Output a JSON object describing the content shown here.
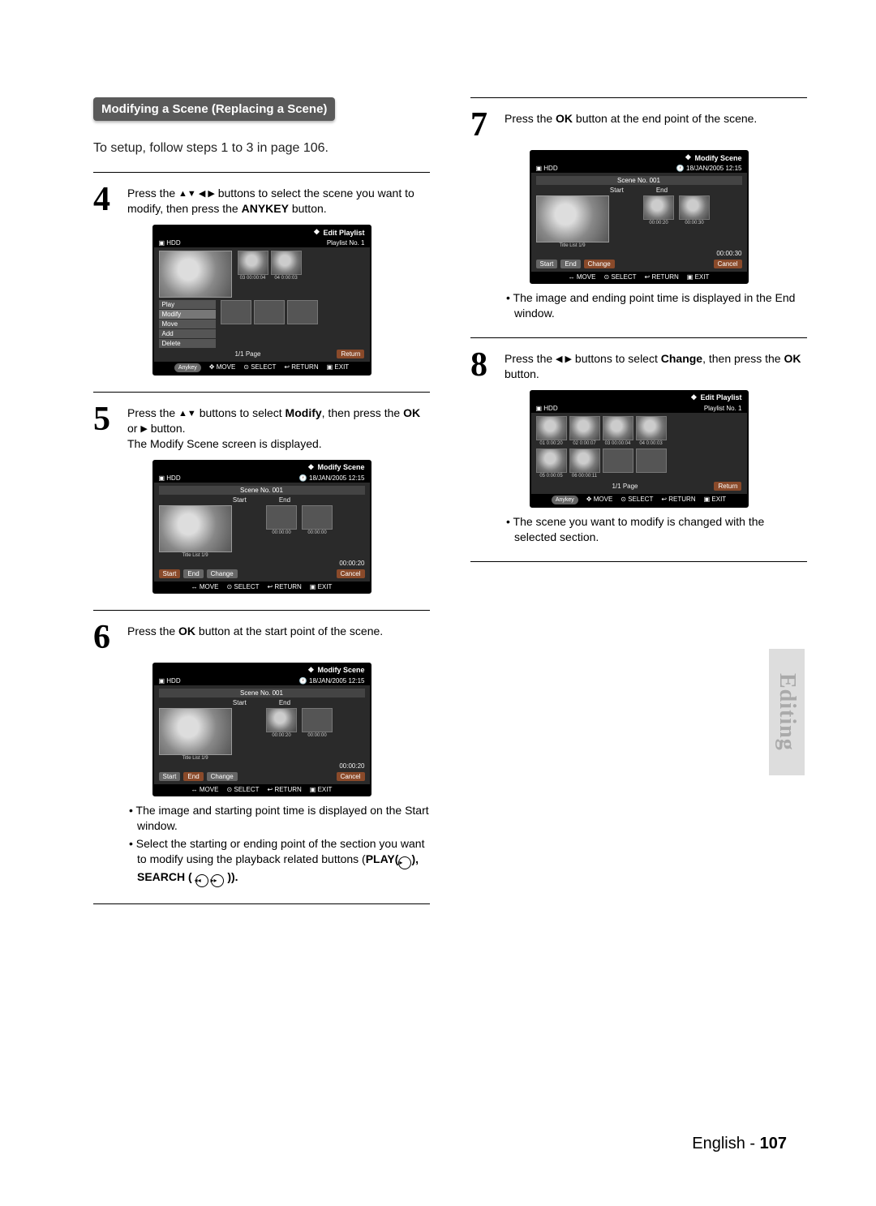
{
  "heading": "Modifying a Scene (Replacing a Scene)",
  "intro": "To setup, follow steps 1 to 3 in page 106.",
  "steps": {
    "s4": {
      "num": "4",
      "text_a": "Press the ",
      "text_b": " buttons to select the scene you want to modify, then press the ",
      "bold": "ANYKEY",
      "text_c": " button."
    },
    "s5": {
      "num": "5",
      "text_a": "Press the ",
      "text_b": " buttons to select ",
      "bold1": "Modify",
      "text_c": ", then press the ",
      "bold2": "OK",
      "text_d": " or ",
      "text_e": " button.",
      "line2": "The Modify Scene screen is displayed."
    },
    "s6": {
      "num": "6",
      "text_a": "Press the ",
      "bold": "OK",
      "text_b": " button at the start point of the scene."
    },
    "s6_bullets": {
      "b1": "The image and starting point time is displayed on the Start window.",
      "b2_a": "Select the starting or ending point of the section you want to modify using the playback related buttons (",
      "b2_play": "PLAY(",
      "b2_sep": "), ",
      "b2_search": "SEARCH (",
      "b2_end": " ))."
    },
    "s7": {
      "num": "7",
      "text_a": "Press the ",
      "bold": "OK",
      "text_b": " button at the end point of the scene."
    },
    "s7_bullet": "The image and ending point time is displayed in the End window.",
    "s8": {
      "num": "8",
      "text_a": "Press the ",
      "text_b": " buttons to select ",
      "bold1": "Change",
      "text_c": ", then press the ",
      "bold2": "OK",
      "text_d": " button."
    },
    "s8_bullet": "The scene you want to modify is changed with the selected section."
  },
  "arrows": {
    "udlr": "▲▼ ◀ ▶",
    "ud": "▲▼",
    "right": "▶",
    "lr": "◀ ▶"
  },
  "ss_common": {
    "hdd": "HDD",
    "date": "18/JAN/2005 12:15",
    "move": "MOVE",
    "select": "SELECT",
    "return": "RETURN",
    "exit": "EXIT",
    "playlist_no": "Playlist No. 1",
    "scene_no": "Scene No. 001",
    "start": "Start",
    "end": "End",
    "change": "Change",
    "cancel": "Cancel",
    "title_list": "Title List 1/9",
    "page": "1/1 Page",
    "return_btn": "Return",
    "anykey": "Anykey"
  },
  "ss4": {
    "title": "Edit Playlist",
    "menu": [
      "Play",
      "Modify",
      "Move",
      "Add",
      "Delete"
    ],
    "thumbs": [
      "03   00:00:04",
      "04   0:00:03"
    ]
  },
  "ss5": {
    "title": "Modify Scene",
    "t1": "00:00:00",
    "t2": "00:00:00",
    "total": "00:00:20"
  },
  "ss6": {
    "title": "Modify Scene",
    "t1": "00:00:20",
    "t2": "00:00:00",
    "total": "00:00:20"
  },
  "ss7": {
    "title": "Modify Scene",
    "t1": "00:00:20",
    "t2": "00:00:30",
    "total": "00:00:30"
  },
  "ss8": {
    "title": "Edit Playlist",
    "thumbs": [
      "01  0:00:20",
      "02  0:00:07",
      "03  00:00:04",
      "04  0:00:03",
      "05  0:00:05",
      "06  00:00:11"
    ]
  },
  "side_tab": "Editing",
  "footer": {
    "lang": "English - ",
    "page": "107"
  },
  "icons": {
    "diamond": "❖",
    "upl": "↕",
    "lrarr": "↔",
    "ret": "↩",
    "xx": "✖",
    "play": "▸",
    "rw": "◂◂",
    "ff": "▸▸"
  }
}
